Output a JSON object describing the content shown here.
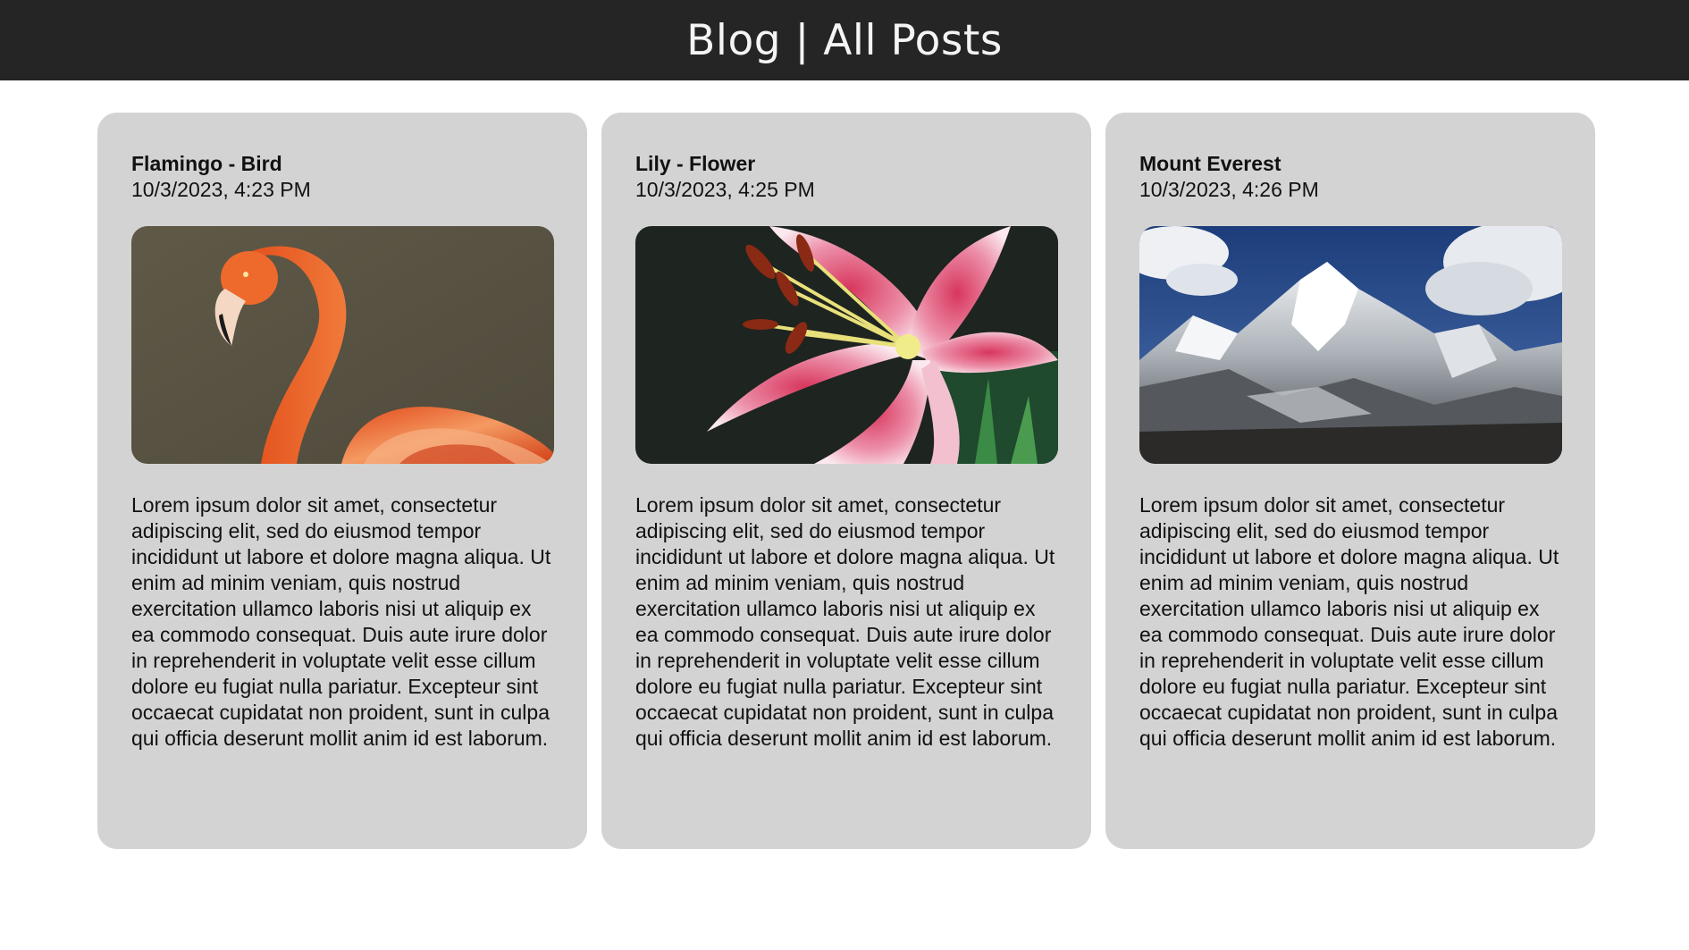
{
  "header": {
    "title": "Blog | All Posts",
    "background": "#252525"
  },
  "posts": [
    {
      "title": "Flamingo - Bird",
      "date": "10/3/2023, 4:23 PM",
      "image_icon": "flamingo-image",
      "excerpt": "Lorem ipsum dolor sit amet, consectetur adipiscing elit, sed do eiusmod tempor incididunt ut labore et dolore magna aliqua. Ut enim ad minim veniam, quis nostrud exercitation ullamco laboris nisi ut aliquip ex ea commodo consequat. Duis aute irure dolor in reprehenderit in voluptate velit esse cillum dolore eu fugiat nulla pariatur. Excepteur sint occaecat cupidatat non proident, sunt in culpa qui officia deserunt mollit anim id est laborum."
    },
    {
      "title": "Lily - Flower",
      "date": "10/3/2023, 4:25 PM",
      "image_icon": "lily-image",
      "excerpt": "Lorem ipsum dolor sit amet, consectetur adipiscing elit, sed do eiusmod tempor incididunt ut labore et dolore magna aliqua. Ut enim ad minim veniam, quis nostrud exercitation ullamco laboris nisi ut aliquip ex ea commodo consequat. Duis aute irure dolor in reprehenderit in voluptate velit esse cillum dolore eu fugiat nulla pariatur. Excepteur sint occaecat cupidatat non proident, sunt in culpa qui officia deserunt mollit anim id est laborum."
    },
    {
      "title": "Mount Everest",
      "date": "10/3/2023, 4:26 PM",
      "image_icon": "mountain-image",
      "excerpt": "Lorem ipsum dolor sit amet, consectetur adipiscing elit, sed do eiusmod tempor incididunt ut labore et dolore magna aliqua. Ut enim ad minim veniam, quis nostrud exercitation ullamco laboris nisi ut aliquip ex ea commodo consequat. Duis aute irure dolor in reprehenderit in voluptate velit esse cillum dolore eu fugiat nulla pariatur. Excepteur sint occaecat cupidatat non proident, sunt in culpa qui officia deserunt mollit anim id est laborum."
    }
  ],
  "colors": {
    "card_background": "#d3d3d3",
    "page_background": "#ffffff",
    "header_text": "#f4f4f4"
  }
}
